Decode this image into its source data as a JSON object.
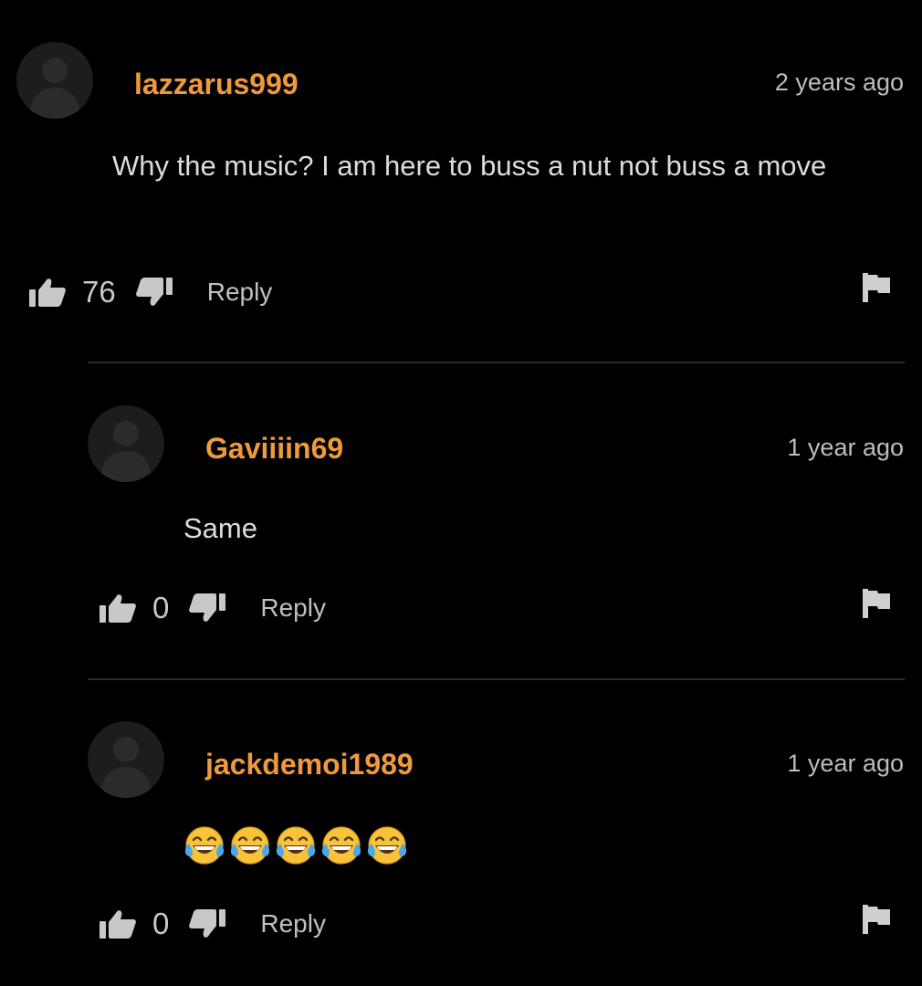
{
  "colors": {
    "background": "#000000",
    "username": "#ee9a3c",
    "text": "#dcdcdc",
    "muted": "#bdbdbd",
    "divider": "#2b2b2b"
  },
  "comments": [
    {
      "username": "lazzarus999",
      "timestamp": "2 years ago",
      "text": "Why the music? I am here to buss a nut not buss a move",
      "likes": "76",
      "reply_label": "Reply",
      "avatar_icon": "user-silhouette-icon"
    },
    {
      "username": "Gaviiiin69",
      "timestamp": "1 year ago",
      "text": "Same",
      "likes": "0",
      "reply_label": "Reply",
      "avatar_icon": "user-silhouette-icon"
    },
    {
      "username": "jackdemoi1989",
      "timestamp": "1 year ago",
      "text": "😂😂😂😂😂",
      "emoji_name": "face-with-tears-of-joy",
      "emoji_count": 5,
      "likes": "0",
      "reply_label": "Reply",
      "avatar_icon": "user-silhouette-icon"
    }
  ],
  "icons": {
    "like": "thumbs-up-icon",
    "dislike": "thumbs-down-icon",
    "report": "flag-icon"
  }
}
